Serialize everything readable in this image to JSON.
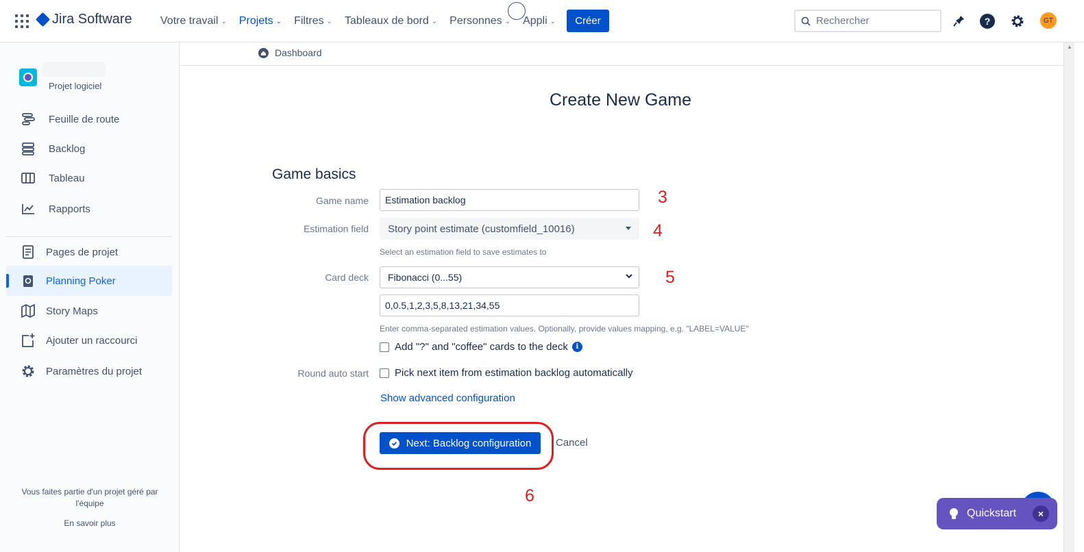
{
  "topbar": {
    "brand": "Jira Software",
    "nav": [
      {
        "label": "Votre travail",
        "active": false
      },
      {
        "label": "Projets",
        "active": true
      },
      {
        "label": "Filtres",
        "active": false
      },
      {
        "label": "Tableaux de bord",
        "active": false
      },
      {
        "label": "Personnes",
        "active": false
      },
      {
        "label": "Appli",
        "active": false
      }
    ],
    "create_label": "Créer",
    "search_placeholder": "Rechercher",
    "avatar_initials": "GT",
    "icons": [
      "apps-grid-icon",
      "notifications-icon",
      "help-icon",
      "settings-icon"
    ]
  },
  "sidebar": {
    "project_type": "Projet logiciel",
    "items": [
      {
        "label": "Feuille de route",
        "icon": "roadmap-icon",
        "active": false
      },
      {
        "label": "Backlog",
        "icon": "backlog-icon",
        "active": false
      },
      {
        "label": "Tableau",
        "icon": "board-icon",
        "active": false
      },
      {
        "label": "Rapports",
        "icon": "reports-icon",
        "active": false
      },
      {
        "label": "Pages de projet",
        "icon": "pages-icon",
        "active": false
      },
      {
        "label": "Planning Poker",
        "icon": "planning-poker-icon",
        "active": true
      },
      {
        "label": "Story Maps",
        "icon": "map-icon",
        "active": false
      },
      {
        "label": "Ajouter un raccourci",
        "icon": "add-shortcut-icon",
        "active": false
      },
      {
        "label": "Paramètres du projet",
        "icon": "settings-icon",
        "active": false
      }
    ],
    "footer_text": "Vous faites partie d'un projet géré par l'équipe",
    "footer_link": "En savoir plus"
  },
  "breadcrumb": {
    "label": "Dashboard"
  },
  "form": {
    "page_title": "Create New Game",
    "section_title": "Game basics",
    "game_name_label": "Game name",
    "game_name_value": "Estimation backlog",
    "estimation_field_label": "Estimation field",
    "estimation_field_value": "Story point estimate (customfield_10016)",
    "estimation_field_help": "Select an estimation field to save estimates to",
    "card_deck_label": "Card deck",
    "card_deck_value": "Fibonacci (0...55)",
    "card_values": "0,0.5,1,2,3,5,8,13,21,34,55",
    "card_values_help": "Enter comma-separated estimation values. Optionally, provide values mapping, e.g. \"LABEL=VALUE\"",
    "coffee_checkbox_label": "Add \"?\" and \"coffee\" cards to the deck",
    "coffee_checked": false,
    "round_auto_start_label": "Round auto start",
    "auto_start_checkbox_label": "Pick next item from estimation backlog automatically",
    "auto_start_checked": false,
    "advanced_link": "Show advanced configuration",
    "next_button": "Next: Backlog configuration",
    "cancel_link": "Cancel"
  },
  "annotations": {
    "a3": "3",
    "a4": "4",
    "a5": "5",
    "a6": "6",
    "color": "#e02020"
  },
  "quickstart": {
    "label": "Quickstart",
    "close": "×"
  },
  "colors": {
    "primary": "#0052cc",
    "quickstart": "#6554c0",
    "active_nav": "#0c66e4"
  }
}
